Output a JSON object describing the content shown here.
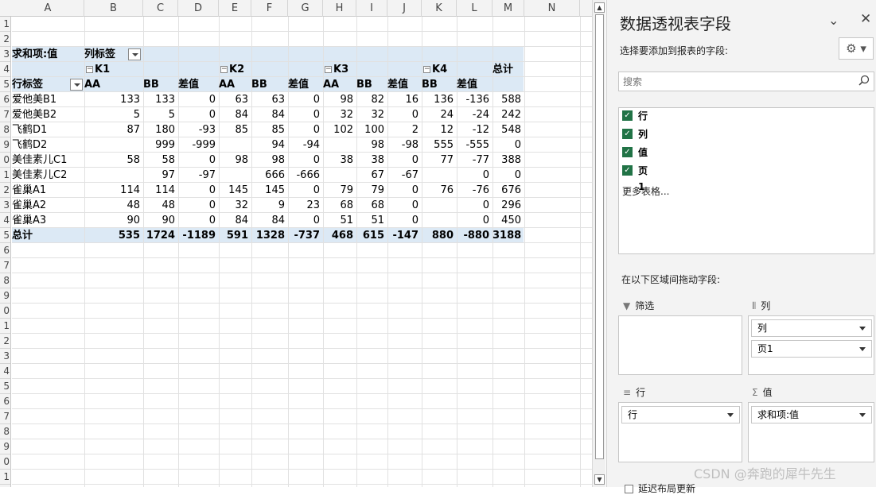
{
  "sheet": {
    "columns": [
      "A",
      "B",
      "C",
      "D",
      "E",
      "F",
      "G",
      "H",
      "I",
      "J",
      "K",
      "L",
      "M",
      "N"
    ],
    "rows": [
      "1",
      "2",
      "3",
      "4",
      "5",
      "6",
      "7",
      "8",
      "9",
      "0",
      "1",
      "2",
      "3",
      "4",
      "5",
      "6",
      "7",
      "8",
      "9",
      "0",
      "1",
      "2",
      "3",
      "4",
      "5",
      "6",
      "7",
      "8",
      "9",
      "0",
      "1"
    ],
    "pivot": {
      "value_caption": "求和项:值",
      "col_label_caption": "列标签",
      "row_label_caption": "行标签",
      "groups": [
        "K1",
        "K2",
        "K3",
        "K4"
      ],
      "grand_total_header": "总计",
      "sub_headers": [
        "AA",
        "BB",
        "差值",
        "AA",
        "BB",
        "差值",
        "AA",
        "BB",
        "差值",
        "BB",
        "差值"
      ],
      "rows": [
        {
          "label": "爱他美B1",
          "vals": [
            "133",
            "133",
            "0",
            "63",
            "63",
            "0",
            "98",
            "82",
            "16",
            "136",
            "-136",
            "588"
          ]
        },
        {
          "label": "爱他美B2",
          "vals": [
            "5",
            "5",
            "0",
            "84",
            "84",
            "0",
            "32",
            "32",
            "0",
            "24",
            "-24",
            "242"
          ]
        },
        {
          "label": "飞鹤D1",
          "vals": [
            "87",
            "180",
            "-93",
            "85",
            "85",
            "0",
            "102",
            "100",
            "2",
            "12",
            "-12",
            "548"
          ]
        },
        {
          "label": "飞鹤D2",
          "vals": [
            "",
            "999",
            "-999",
            "",
            "94",
            "-94",
            "",
            "98",
            "-98",
            "555",
            "-555",
            "0"
          ]
        },
        {
          "label": "美佳素儿C1",
          "vals": [
            "58",
            "58",
            "0",
            "98",
            "98",
            "0",
            "38",
            "38",
            "0",
            "77",
            "-77",
            "388"
          ]
        },
        {
          "label": "美佳素儿C2",
          "vals": [
            "",
            "97",
            "-97",
            "",
            "666",
            "-666",
            "",
            "67",
            "-67",
            "",
            "0",
            "0"
          ]
        },
        {
          "label": "雀巢A1",
          "vals": [
            "114",
            "114",
            "0",
            "145",
            "145",
            "0",
            "79",
            "79",
            "0",
            "76",
            "-76",
            "676"
          ]
        },
        {
          "label": "雀巢A2",
          "vals": [
            "48",
            "48",
            "0",
            "32",
            "9",
            "23",
            "68",
            "68",
            "0",
            "",
            "0",
            "296"
          ]
        },
        {
          "label": "雀巢A3",
          "vals": [
            "90",
            "90",
            "0",
            "84",
            "84",
            "0",
            "51",
            "51",
            "0",
            "",
            "0",
            "450"
          ]
        }
      ],
      "total_row": {
        "label": "总计",
        "vals": [
          "535",
          "1724",
          "-1189",
          "591",
          "1328",
          "-737",
          "468",
          "615",
          "-147",
          "880",
          "-880",
          "3188"
        ]
      }
    }
  },
  "pane": {
    "title": "数据透视表字段",
    "subtitle": "选择要添加到报表的字段:",
    "search_placeholder": "搜索",
    "fields": [
      "行",
      "列",
      "值",
      "页1"
    ],
    "more_tables": "更多表格...",
    "drag_label": "在以下区域间拖动字段:",
    "areas": {
      "filter": {
        "title": "筛选",
        "icon": "filter-icon"
      },
      "columns": {
        "title": "列",
        "icon": "columns-icon",
        "items": [
          "列",
          "页1"
        ]
      },
      "rows": {
        "title": "行",
        "icon": "rows-icon",
        "items": [
          "行"
        ]
      },
      "values": {
        "title": "值",
        "icon": "sigma-icon",
        "items": [
          "求和项:值"
        ]
      }
    },
    "defer_update": "延迟布局更新"
  },
  "watermark": "CSDN @奔跑的犀牛先生"
}
